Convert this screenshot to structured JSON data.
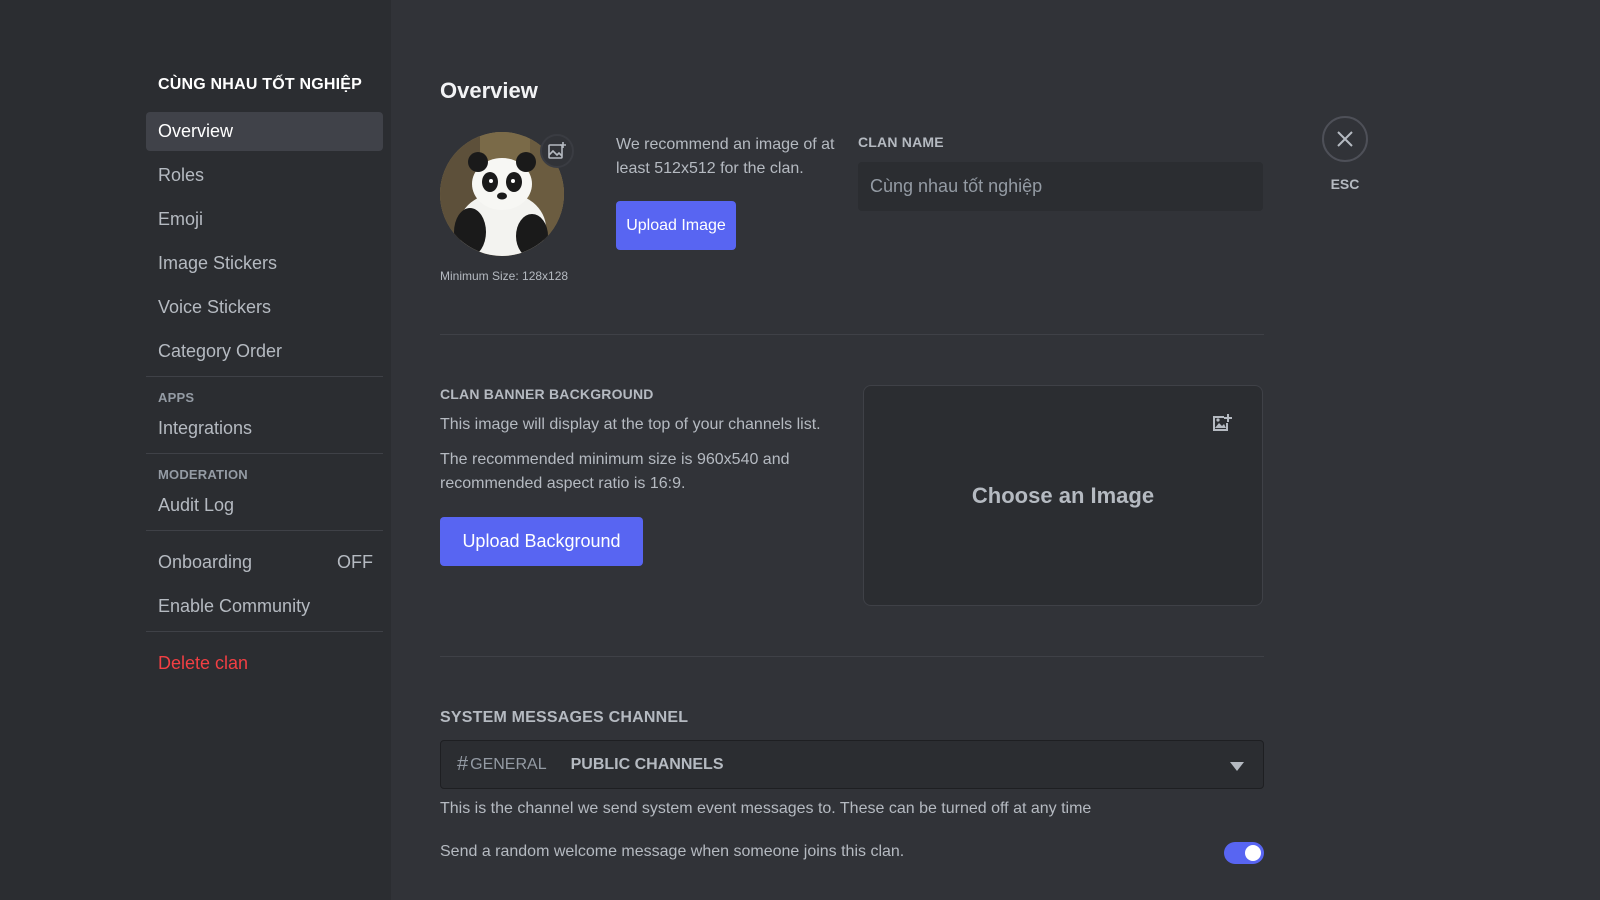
{
  "sidebar": {
    "server_title": "CÙNG NHAU TỐT NGHIỆP",
    "items_main": [
      {
        "label": "Overview"
      },
      {
        "label": "Roles"
      },
      {
        "label": "Emoji"
      },
      {
        "label": "Image Stickers"
      },
      {
        "label": "Voice Stickers"
      },
      {
        "label": "Category Order"
      }
    ],
    "apps_header": "APPS",
    "integrations": "Integrations",
    "moderation_header": "MODERATION",
    "audit_log": "Audit Log",
    "onboarding": "Onboarding",
    "onboarding_status": "OFF",
    "enable_community": "Enable Community",
    "delete_clan": "Delete clan"
  },
  "main": {
    "title": "Overview",
    "avatar_min_size": "Minimum Size: 128x128",
    "recommend_text": "We recommend an image of at least 512x512 for the clan.",
    "upload_image_label": "Upload Image",
    "clan_name_label": "CLAN NAME",
    "clan_name_value": "Cùng nhau tốt nghiệp",
    "banner_label": "CLAN BANNER BACKGROUND",
    "banner_desc1": "This image will display at the top of your channels list.",
    "banner_desc2": "The recommended minimum size is 960x540 and recommended aspect ratio is 16:9.",
    "upload_background_label": "Upload Background",
    "choose_image_label": "Choose an Image",
    "system_channel_label": "SYSTEM MESSAGES CHANNEL",
    "channel_hash": "#",
    "channel_name": "GENERAL",
    "channel_group": "PUBLIC CHANNELS",
    "system_channel_help": "This is the channel we send system event messages to. These can be turned off at any time",
    "welcome_message_text": "Send a random welcome message when someone joins this clan.",
    "welcome_toggle_on": true
  },
  "close": {
    "esc_label": "ESC"
  },
  "colors": {
    "accent": "#5865f2",
    "danger": "#f23f43",
    "sidebar_bg": "#2b2d31",
    "main_bg": "#313338"
  }
}
